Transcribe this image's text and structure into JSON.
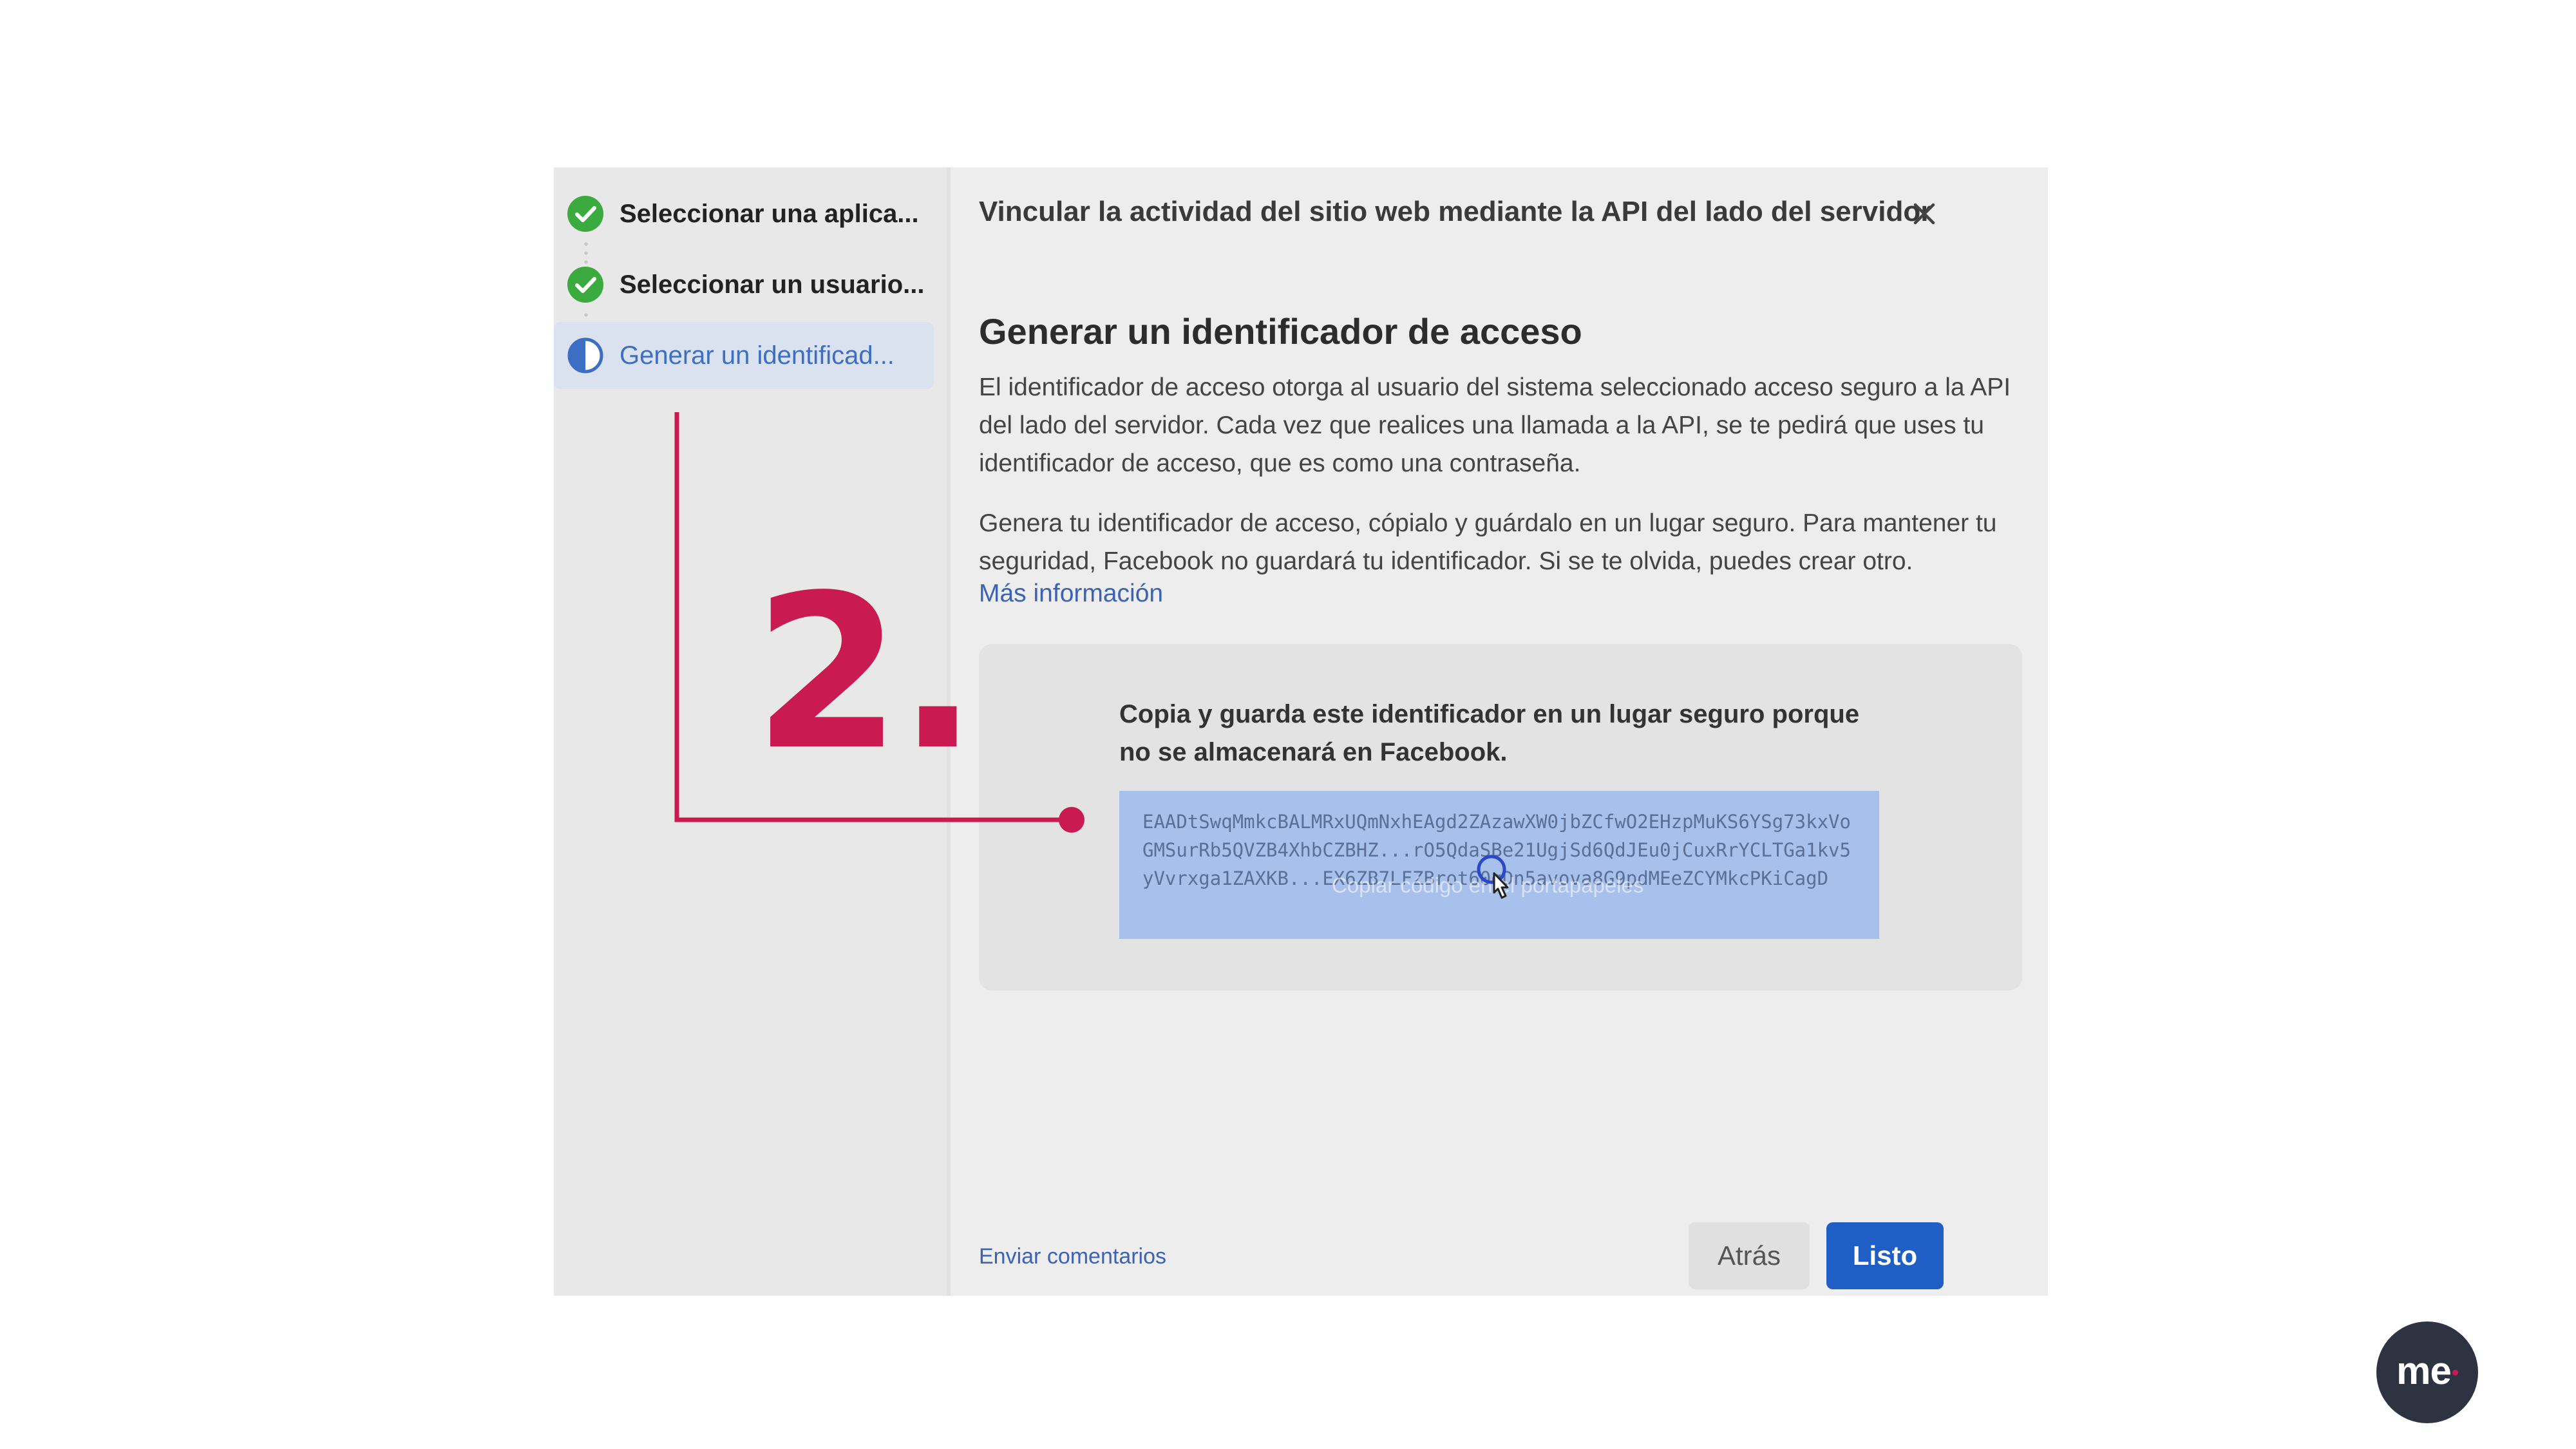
{
  "sidebar": {
    "steps": [
      {
        "label": "Seleccionar una aplica...",
        "status": "complete"
      },
      {
        "label": "Seleccionar un usuario...",
        "status": "complete"
      },
      {
        "label": "Generar un identificad...",
        "status": "in-progress"
      }
    ]
  },
  "dialog": {
    "title": "Vincular la actividad del sitio web mediante la API del lado del servidor",
    "section_title": "Generar un identificador de acceso",
    "paragraph_1": "El identificador de acceso otorga al usuario del sistema seleccionado acceso seguro a la API del lado del servidor. Cada vez que realices una llamada a la API, se te pedirá que uses tu identificador de acceso, que es como una contraseña.",
    "paragraph_2": "Genera tu identificador de acceso, cópialo y guárdalo en un lugar seguro. Para mantener tu seguridad, Facebook no guardará tu identificador. Si se te olvida, puedes crear otro.",
    "more_info_link": "Más información",
    "token_heading": "Copia y guarda este identificador en un lugar seguro porque no se almacenará en Facebook.",
    "token_value": "EAADtSwqMmkcBALMRxUQmNxhEAgd2ZAzawXW0jbZCfwO2EHzpMuKS6YSg73kxVoGMSurRb5QVZB4XhbCZBHZ...rO5QdaSBe21UgjSd6QdJEu0jCuxRrYCLTGa1kv5yVvrxga1ZAXKB...EX6ZB7LFZBrot60qDn5avova8G9pdMEeZCYMkcPKiCagD",
    "copy_hint": "Copiar código en el portapapeles",
    "feedback_link": "Enviar comentarios",
    "back_button": "Atrás",
    "done_button": "Listo"
  },
  "annotation": {
    "number": "2."
  },
  "brand": {
    "logo_text": "me"
  },
  "colors": {
    "accent": "#c91a52",
    "primary_button": "#1f5fc5",
    "link": "#3b62b5",
    "success": "#3bab3f"
  }
}
